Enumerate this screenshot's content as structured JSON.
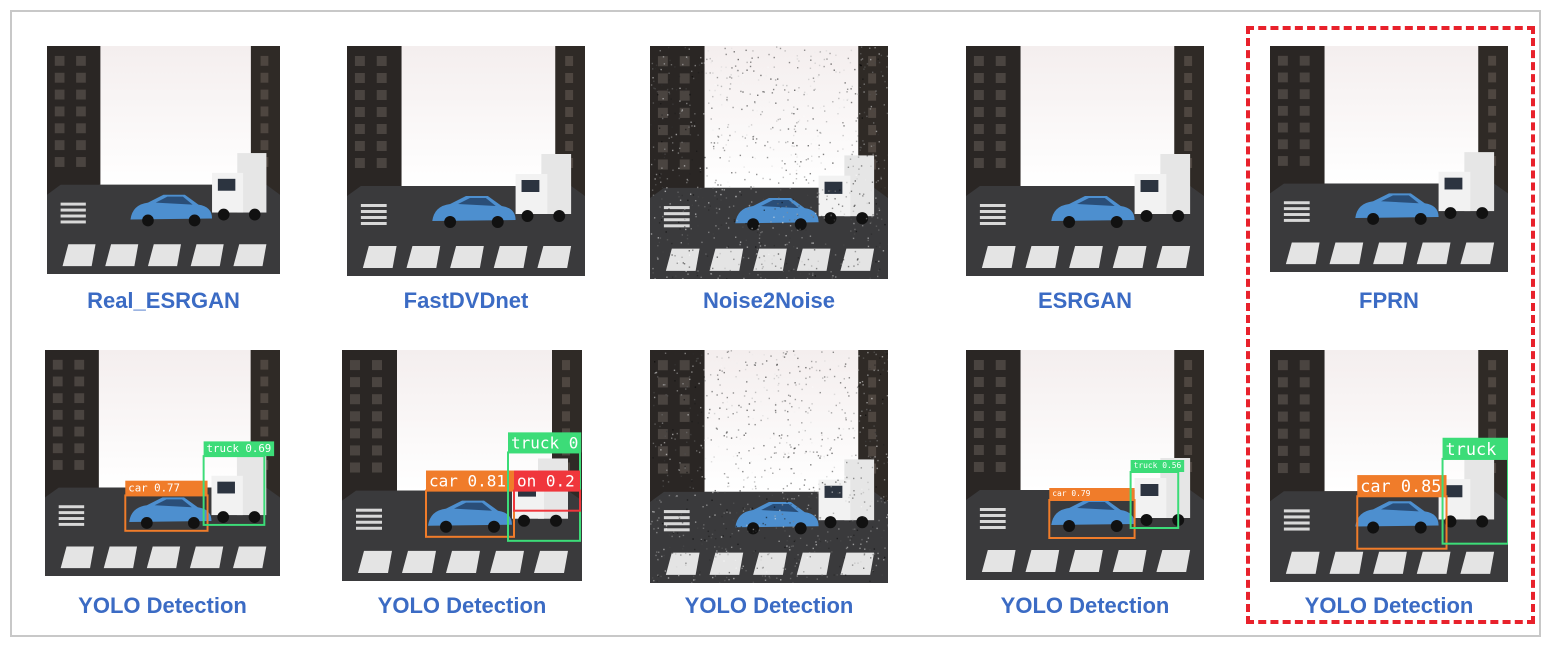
{
  "panels": {
    "row1": [
      {
        "id": "real_esrgan",
        "caption": "Real_ESRGAN",
        "noise": false,
        "detections": []
      },
      {
        "id": "fastdvdnet",
        "caption": "FastDVDnet",
        "noise": false,
        "detections": []
      },
      {
        "id": "noise2noise",
        "caption": "Noise2Noise",
        "noise": true,
        "detections": []
      },
      {
        "id": "esrgan",
        "caption": "ESRGAN",
        "noise": false,
        "detections": []
      },
      {
        "id": "fprn",
        "caption": "FPRN",
        "noise": false,
        "detections": []
      }
    ],
    "row2": [
      {
        "id": "yolo_real_esrgan",
        "caption": "YOLO Detection",
        "noise": false,
        "detections": [
          {
            "label": "car 0.77",
            "color": "#f07c2a"
          },
          {
            "label": "truck 0.69",
            "color": "#3cdc78"
          }
        ]
      },
      {
        "id": "yolo_fastdvdnet",
        "caption": "YOLO Detection",
        "noise": false,
        "detections": [
          {
            "label": "car 0.81",
            "color": "#f07c2a"
          },
          {
            "label": "truck 0",
            "color": "#3cdc78"
          },
          {
            "label": "on 0.2",
            "color": "#f0363c"
          }
        ]
      },
      {
        "id": "yolo_noise2noise",
        "caption": "YOLO Detection",
        "noise": true,
        "detections": []
      },
      {
        "id": "yolo_esrgan",
        "caption": "YOLO Detection",
        "noise": false,
        "detections": [
          {
            "label": "car 0.79",
            "color": "#f07c2a"
          },
          {
            "label": "truck 0.56",
            "color": "#3cdc78"
          }
        ]
      },
      {
        "id": "yolo_fprn",
        "caption": "YOLO Detection",
        "noise": false,
        "detections": [
          {
            "label": "car 0.85",
            "color": "#f07c2a"
          },
          {
            "label": "truck (",
            "color": "#3cdc78"
          }
        ]
      }
    ]
  },
  "colors": {
    "caption": "#3b6bc4",
    "highlight": "#e8212b",
    "frame": "#c8c8c8"
  }
}
